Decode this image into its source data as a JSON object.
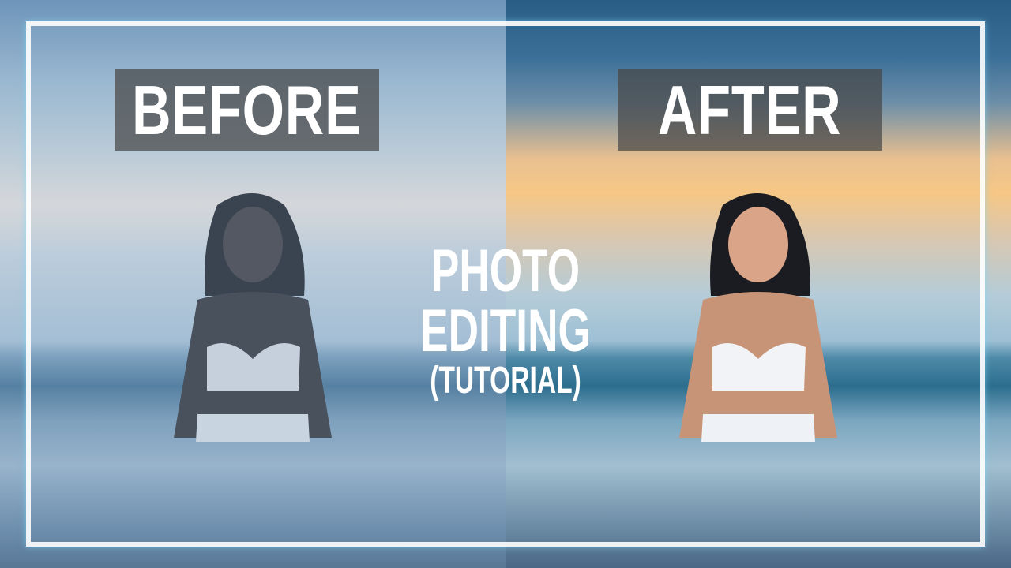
{
  "labels": {
    "before": "BEFORE",
    "after": "AFTER"
  },
  "title": {
    "line1": "PHOTO EDITING",
    "line2": "(TUTORIAL)"
  },
  "colors": {
    "frame": "#ffffff",
    "label_bg": "#464646",
    "text": "#ffffff"
  }
}
